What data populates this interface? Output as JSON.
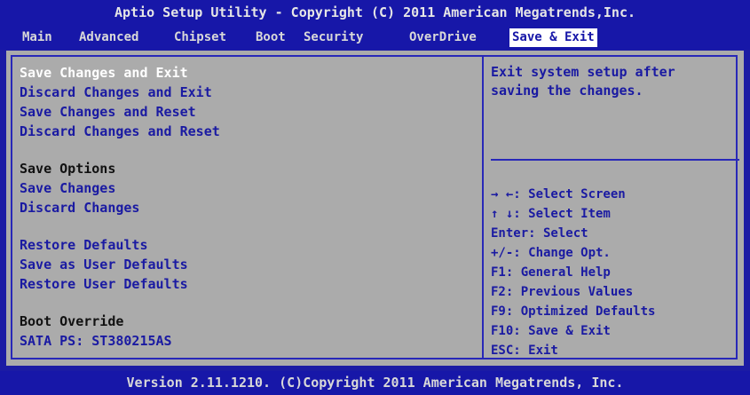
{
  "title": "Aptio Setup Utility - Copyright (C) 2011 American Megatrends,Inc.",
  "menu": {
    "tabs": [
      {
        "label": "Main"
      },
      {
        "label": "Advanced"
      },
      {
        "label": "Chipset"
      },
      {
        "label": "Boot"
      },
      {
        "label": "Security"
      },
      {
        "label": "OverDrive"
      },
      {
        "label": "Save & Exit",
        "active": true
      }
    ]
  },
  "options": {
    "save_changes_and_exit": "Save Changes and Exit",
    "discard_changes_and_exit": "Discard Changes and Exit",
    "save_changes_and_reset": "Save Changes and Reset",
    "discard_changes_and_reset": "Discard Changes and Reset",
    "save_options_label": "Save Options",
    "save_changes": "Save Changes",
    "discard_changes": "Discard Changes",
    "restore_defaults": "Restore Defaults",
    "save_as_user_defaults": "Save as User Defaults",
    "restore_user_defaults": "Restore User Defaults",
    "boot_override_label": "Boot Override",
    "boot_device": "SATA PS: ST380215AS"
  },
  "help": {
    "text": "Exit system setup after\nsaving the changes."
  },
  "keys": {
    "select_screen": "→ ←: Select Screen",
    "select_item": "↑ ↓: Select Item",
    "enter": "Enter: Select",
    "change_opt": "+/-:  Change Opt.",
    "f1": "F1: General Help",
    "f2": "F2: Previous Values",
    "f9": "F9: Optimized Defaults",
    "f10": "F10: Save & Exit",
    "esc": "ESC: Exit"
  },
  "footer": "Version 2.11.1210. (C)Copyright 2011 American Megatrends, Inc.",
  "colors": {
    "background_blue": "#1717a8",
    "panel_gray": "#ababab",
    "option_text": "#1a1aa2",
    "selected_text": "#ffffff"
  }
}
